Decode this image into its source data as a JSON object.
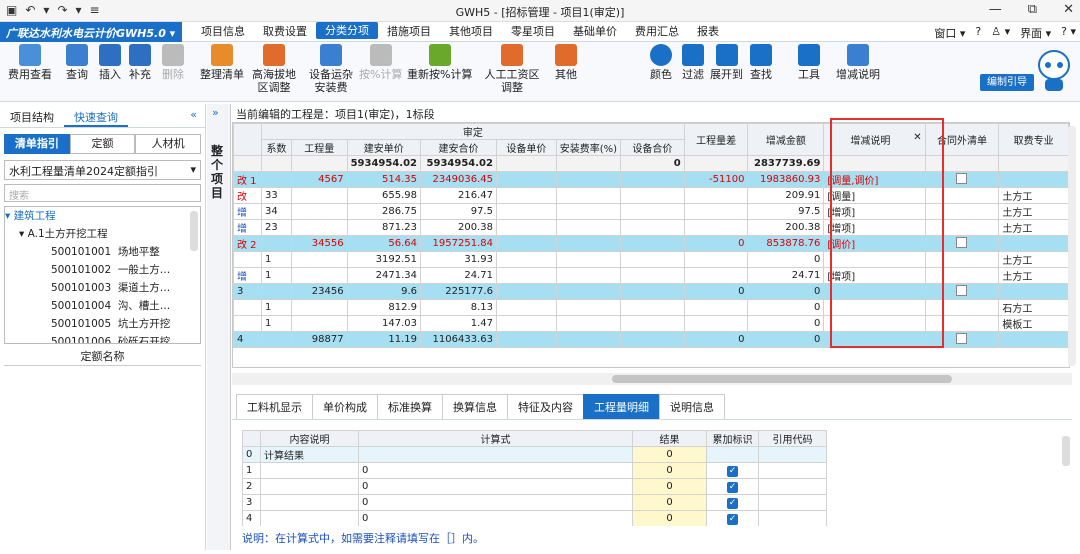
{
  "title_bar": {
    "title": "GWH5 - [招标管理 - 项目1(审定)]",
    "qa": [
      "▣",
      "↶",
      "▾",
      "↷",
      "▾",
      "≡"
    ],
    "win": [
      "—",
      "⧉",
      "✕"
    ]
  },
  "menu": {
    "brand": "广联达水利水电云计价GWH5.0 ▾",
    "tabs": [
      "项目信息",
      "取费设置",
      "分类分项",
      "措施项目",
      "其他项目",
      "零星项目",
      "基础单价",
      "费用汇总",
      "报表"
    ],
    "right": [
      "窗口 ▾",
      "?",
      "♙ ▾",
      "界面 ▾",
      "? ▾"
    ]
  },
  "ribbon": {
    "items": [
      "费用查看",
      "查询",
      "插入",
      "补充",
      "删除",
      "整理清单",
      "高海拔地区调整",
      "设备运杂安装费",
      "按%计算",
      "重新按%计算",
      "人工工资区调整",
      "其他",
      "颜色",
      "过滤",
      "展开到",
      "查找",
      "工具",
      "增减说明"
    ],
    "help": "编制引导"
  },
  "left": {
    "tabs": [
      "项目结构",
      "快速查询"
    ],
    "seg": [
      "清单指引",
      "定额",
      "人材机"
    ],
    "select": "水利工程量清单2024定额指引",
    "search": "搜索",
    "tree": [
      "建筑工程",
      "A.1土方开挖工程"
    ],
    "codes": [
      "500101001",
      "500101002",
      "500101003",
      "500101004",
      "500101005",
      "500101006"
    ],
    "names": [
      "场地平整",
      "一般土方…",
      "渠道土方…",
      "沟、槽土…",
      "坑土方开挖",
      "砂砾石开挖"
    ],
    "bottom_header": "定额名称"
  },
  "gutter_label": "整个项目",
  "editing": "当前编辑的工程是：项目1(审定)，1标段",
  "grid": {
    "h1": [
      "审定",
      "工程量差",
      "增减金额",
      "增减说明",
      "合同外清单",
      "取费专业"
    ],
    "h2": [
      "系数",
      "工程量",
      "建安单价",
      "建安合价",
      "设备单价",
      "安装费率(%)",
      "设备合价"
    ],
    "total": [
      "",
      "",
      "5934954.02",
      "5934954.02",
      "",
      "",
      "0",
      "",
      "2837739.69"
    ],
    "rows": [
      {
        "m": "改 1",
        "c": [
          "",
          "4567",
          "514.35",
          "2349036.45",
          "",
          "",
          "",
          "-51100",
          "1983860.93",
          "[调量,调价]",
          "",
          ""
        ]
      },
      {
        "m": "改",
        "c": [
          "33",
          "",
          "655.98",
          "216.47",
          "",
          "",
          "",
          "",
          "209.91",
          "[调量]",
          "",
          "土方工"
        ]
      },
      {
        "m": "增",
        "c": [
          "34",
          "",
          "286.75",
          "97.5",
          "",
          "",
          "",
          "",
          "97.5",
          "[增项]",
          "",
          "土方工"
        ]
      },
      {
        "m": "增",
        "c": [
          "23",
          "",
          "871.23",
          "200.38",
          "",
          "",
          "",
          "",
          "200.38",
          "[增项]",
          "",
          "土方工"
        ]
      },
      {
        "m": "改 2",
        "c": [
          "",
          "34556",
          "56.64",
          "1957251.84",
          "",
          "",
          "",
          "0",
          "853878.76",
          "[调价]",
          "",
          ""
        ]
      },
      {
        "m": "",
        "c": [
          "1",
          "",
          "3192.51",
          "31.93",
          "",
          "",
          "",
          "",
          "0",
          "",
          "",
          "土方工"
        ]
      },
      {
        "m": "增",
        "c": [
          "1",
          "",
          "2471.34",
          "24.71",
          "",
          "",
          "",
          "",
          "24.71",
          "[增项]",
          "",
          "土方工"
        ]
      },
      {
        "m": "3",
        "c": [
          "",
          "23456",
          "9.6",
          "225177.6",
          "",
          "",
          "",
          "0",
          "0",
          "",
          "",
          ""
        ]
      },
      {
        "m": "",
        "c": [
          "1",
          "",
          "812.9",
          "8.13",
          "",
          "",
          "",
          "",
          "0",
          "",
          "",
          "石方工"
        ]
      },
      {
        "m": "",
        "c": [
          "1",
          "",
          "147.03",
          "1.47",
          "",
          "",
          "",
          "",
          "0",
          "",
          "",
          "模板工"
        ]
      },
      {
        "m": "4",
        "c": [
          "",
          "98877",
          "11.19",
          "1106433.63",
          "",
          "",
          "",
          "0",
          "0",
          "",
          "",
          ""
        ]
      }
    ]
  },
  "bottom": {
    "tabs": [
      "工料机显示",
      "单价构成",
      "标准换算",
      "换算信息",
      "特征及内容",
      "工程量明细",
      "说明信息"
    ],
    "headers": [
      "内容说明",
      "计算式",
      "结果",
      "累加标识",
      "引用代码"
    ],
    "rows": [
      [
        "0",
        "计算结果",
        "",
        "0"
      ],
      [
        "1",
        "",
        "0",
        "0"
      ],
      [
        "2",
        "",
        "0",
        "0"
      ],
      [
        "3",
        "",
        "0",
        "0"
      ],
      [
        "4",
        "",
        "0",
        "0"
      ]
    ],
    "note": "说明：在计算式中，如需要注释请填写在［］内。"
  },
  "colors": {
    "accent": "#1a6fc6",
    "row_cyan": "#a6def2",
    "highlight": "#e0302f"
  }
}
